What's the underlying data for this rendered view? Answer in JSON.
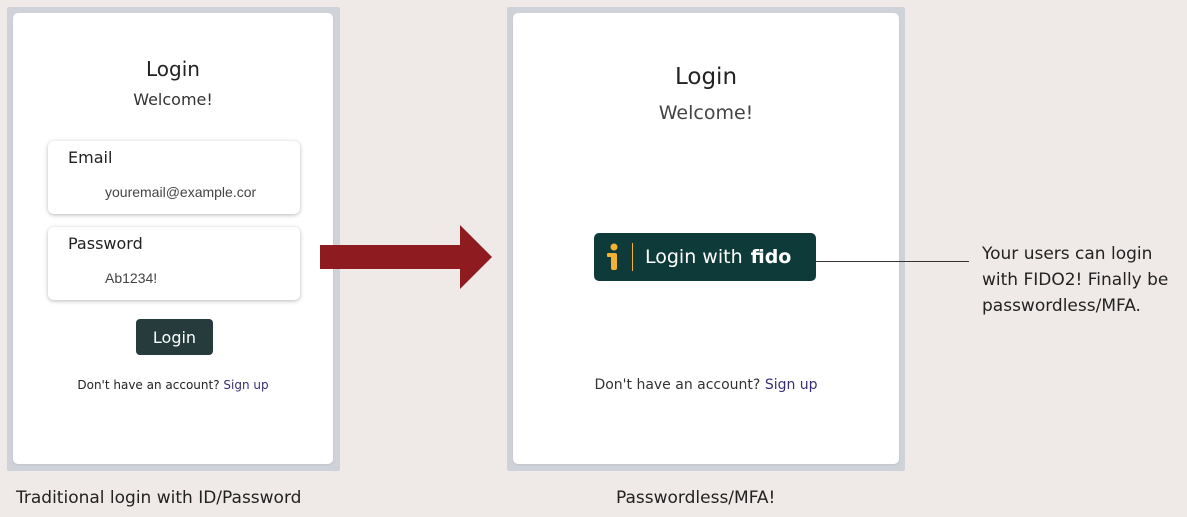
{
  "left_panel": {
    "title": "Login",
    "subtitle": "Welcome!",
    "email_label": "Email",
    "email_value": "youremail@example.cor",
    "password_label": "Password",
    "password_value": "Ab1234!",
    "login_button": "Login",
    "signup_prompt": "Don't have an account?",
    "signup_link": "Sign up",
    "caption": "Traditional login with ID/Password"
  },
  "right_panel": {
    "title": "Login",
    "subtitle": "Welcome!",
    "fido_button_prefix": "Login with",
    "fido_brand": "fido",
    "signup_prompt": "Don't have an account?",
    "signup_link": "Sign up",
    "caption": "Passwordless/MFA!"
  },
  "callout": {
    "text": "Your users can login with FIDO2! Finally be passwordless/MFA."
  },
  "colors": {
    "arrow": "#8e1b20",
    "fido_bg": "#0f3a3a",
    "fido_accent": "#f2b233",
    "login_button_bg": "#253b3c",
    "link": "#3b2d73"
  }
}
